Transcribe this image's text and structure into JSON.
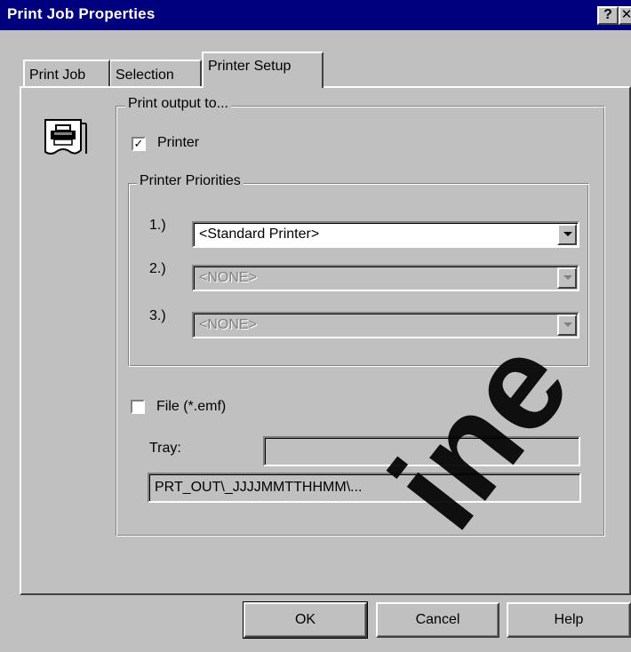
{
  "window": {
    "title": "Print Job Properties",
    "help_button": "?",
    "close_button": "✕"
  },
  "tabs": [
    {
      "label": "Print Job",
      "active": false
    },
    {
      "label": "Selection",
      "active": false
    },
    {
      "label": "Printer Setup",
      "active": true
    }
  ],
  "print_output": {
    "group_label": "Print output to...",
    "icon": "printer-document-icon",
    "printer": {
      "label": "Printer",
      "checked": true,
      "check_glyph": "✓"
    },
    "priorities": {
      "group_label": "Printer Priorities",
      "items": [
        {
          "number": "1.)",
          "value": "<Standard Printer>",
          "enabled": true
        },
        {
          "number": "2.)",
          "value": "<NONE>",
          "enabled": false
        },
        {
          "number": "3.)",
          "value": "<NONE>",
          "enabled": false
        }
      ]
    },
    "file": {
      "label": "File  (*.emf)",
      "checked": false,
      "tray_label": "Tray:",
      "tray_value": "",
      "path_value": "PRT_OUT\\_JJJJMMTTHHMM\\..."
    }
  },
  "buttons": {
    "ok": "OK",
    "cancel": "Cancel",
    "help": "Help"
  },
  "watermark": {
    "text": "ine",
    "text2": "e"
  },
  "colors": {
    "titlebar": "#00007f",
    "face": "#c0c0c0"
  }
}
